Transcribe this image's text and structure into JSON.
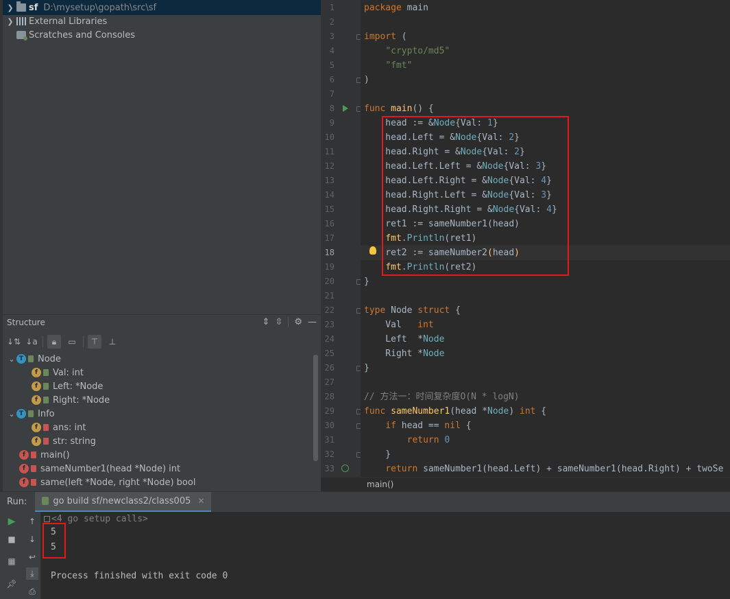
{
  "project_tree": {
    "root": {
      "name": "sf",
      "path": "D:\\mysetup\\gopath\\src\\sf"
    },
    "external_libraries": "External Libraries",
    "scratches": "Scratches and Consoles"
  },
  "structure": {
    "title": "Structure",
    "items": [
      {
        "label": "Node",
        "kind": "type",
        "expanded": true
      },
      {
        "label": "Val: int",
        "kind": "field",
        "public": true
      },
      {
        "label": "Left: *Node",
        "kind": "field",
        "public": true
      },
      {
        "label": "Right: *Node",
        "kind": "field",
        "public": true
      },
      {
        "label": "Info",
        "kind": "type",
        "expanded": true
      },
      {
        "label": "ans: int",
        "kind": "field",
        "public": false
      },
      {
        "label": "str: string",
        "kind": "field",
        "public": false
      },
      {
        "label": "main()",
        "kind": "func",
        "public": false
      },
      {
        "label": "sameNumber1(head *Node) int",
        "kind": "func",
        "public": false
      },
      {
        "label": "same(left *Node, right *Node) bool",
        "kind": "func",
        "public": false
      }
    ]
  },
  "editor": {
    "line_numbers": [
      "1",
      "2",
      "3",
      "4",
      "5",
      "6",
      "7",
      "8",
      "9",
      "10",
      "11",
      "12",
      "13",
      "14",
      "15",
      "16",
      "17",
      "18",
      "19",
      "20",
      "21",
      "22",
      "23",
      "24",
      "25",
      "26",
      "27",
      "28",
      "29",
      "30",
      "31",
      "32",
      "33"
    ],
    "current_line": "18",
    "breadcrumb": "main()"
  },
  "run": {
    "label": "Run:",
    "tab": "go build sf/newclass2/class005",
    "setup_calls": "<4 go setup calls>",
    "output": [
      "5",
      "5"
    ],
    "finished": "Process finished with exit code 0"
  },
  "colors": {
    "keyword": "#cc7832",
    "string": "#6a8759",
    "number": "#6897bb",
    "type": "#6fafbd",
    "function": "#ffc66d",
    "annotation_box": "#e11a1a"
  },
  "icons": [
    "folder-icon",
    "library-icon",
    "scratches-icon",
    "sort-icon",
    "lock-icon",
    "gear-icon",
    "minimize-icon",
    "run-icon",
    "stop-icon",
    "bulb-icon",
    "close-icon",
    "up-arrow-icon",
    "down-arrow-icon",
    "wrap-icon",
    "scroll-end-icon",
    "print-icon",
    "pin-icon"
  ]
}
